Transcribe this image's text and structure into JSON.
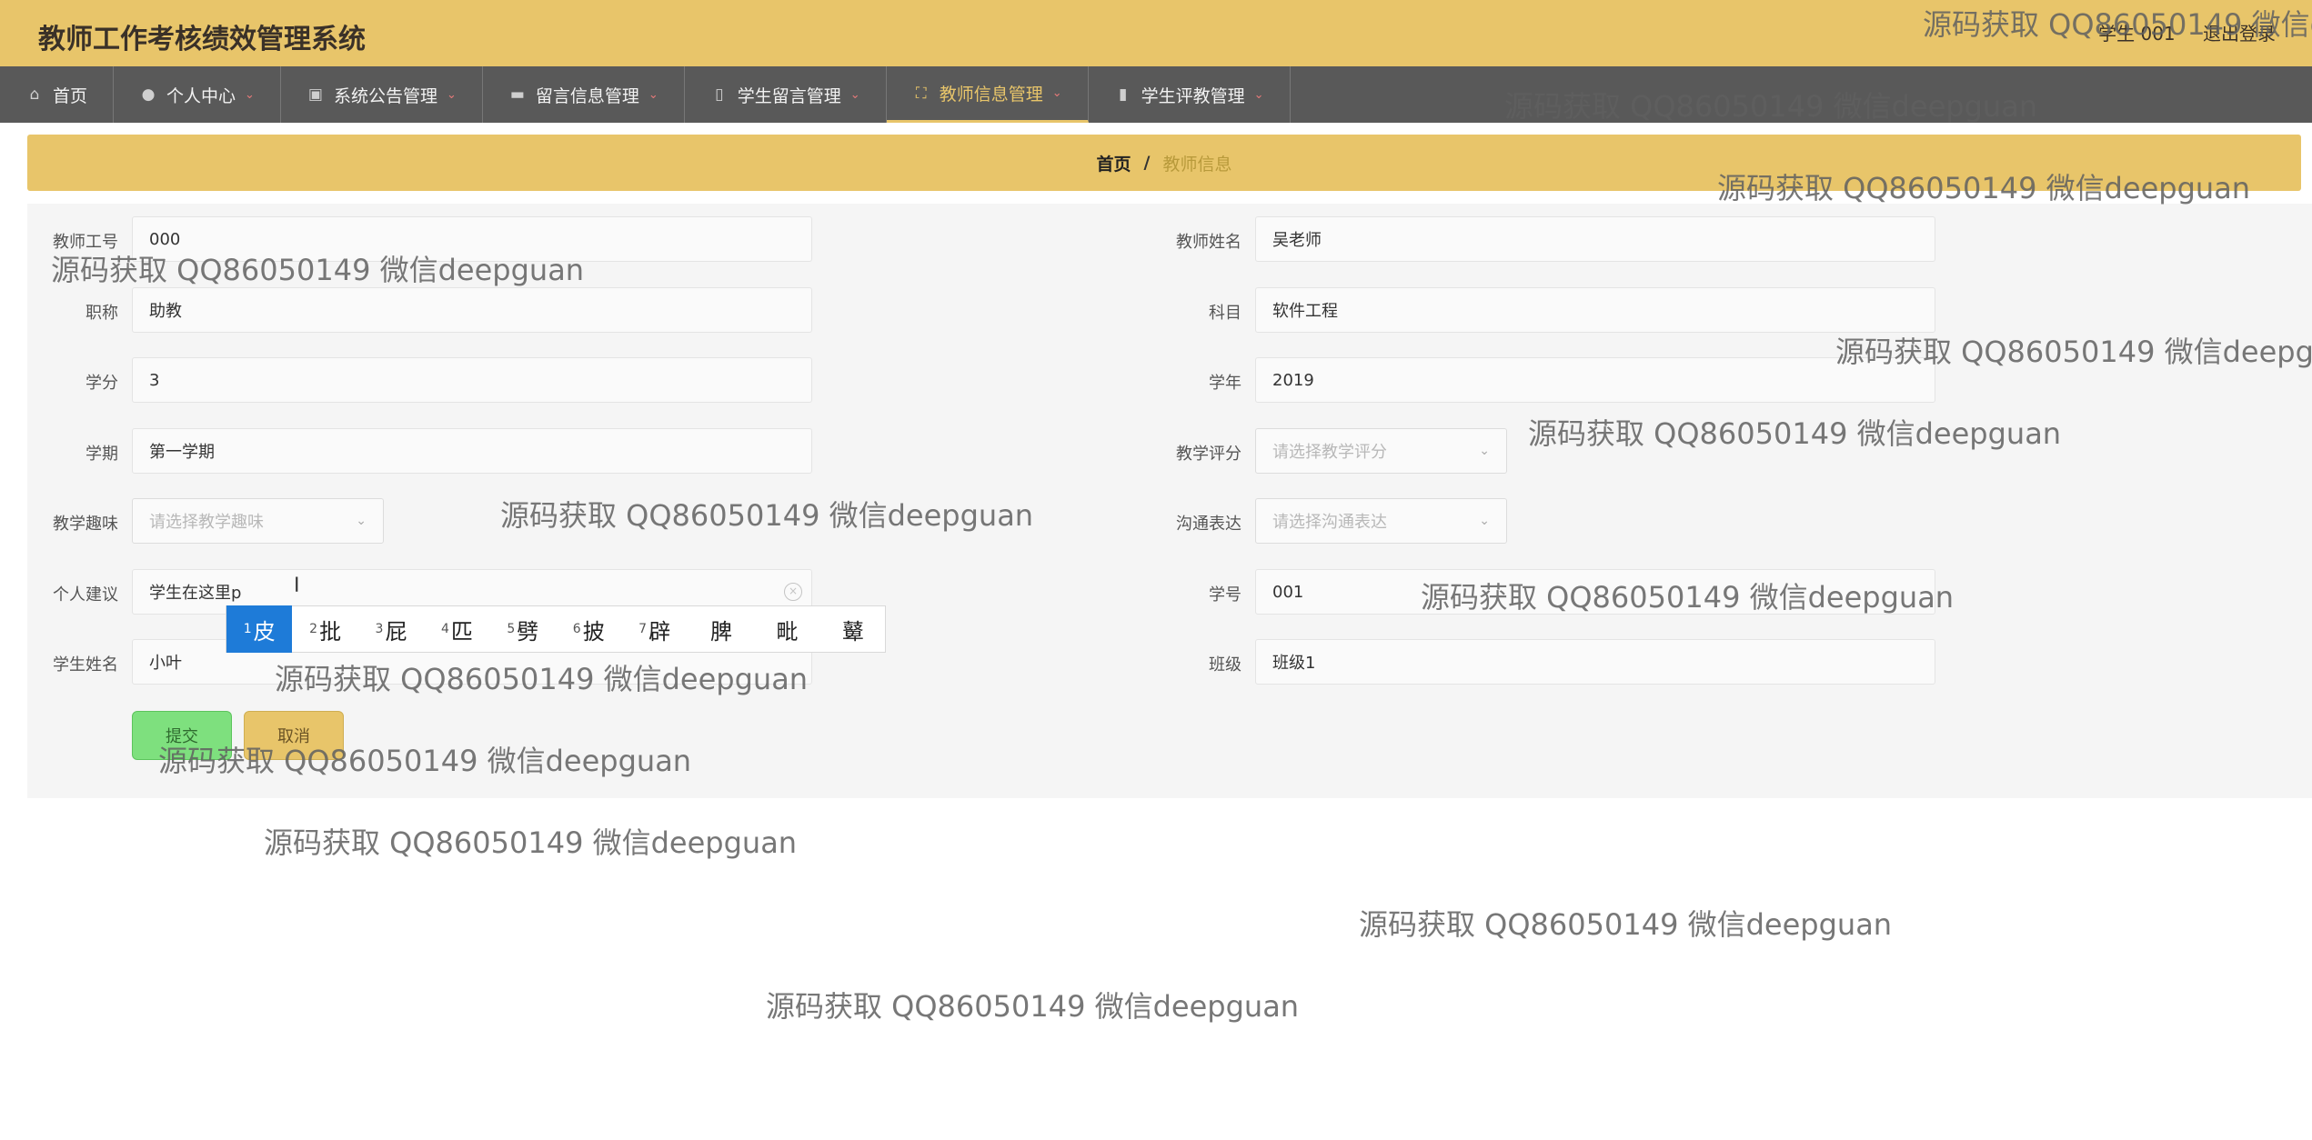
{
  "app": {
    "title": "教师工作考核绩效管理系统",
    "user": "学生 001",
    "logout": "退出登录"
  },
  "nav": [
    {
      "label": "首页",
      "icon": "home-icon",
      "glyph": "⌂",
      "caret": false
    },
    {
      "label": "个人中心",
      "icon": "user-icon",
      "glyph": "●",
      "caret": true
    },
    {
      "label": "系统公告管理",
      "icon": "clipboard-icon",
      "glyph": "▣",
      "caret": true
    },
    {
      "label": "留言信息管理",
      "icon": "message-icon",
      "glyph": "▬",
      "caret": true
    },
    {
      "label": "学生留言管理",
      "icon": "microphone-icon",
      "glyph": "▯",
      "caret": true
    },
    {
      "label": "教师信息管理",
      "icon": "fullscreen-icon",
      "glyph": "⛶",
      "caret": true,
      "active": true
    },
    {
      "label": "学生评教管理",
      "icon": "bar-chart-icon",
      "glyph": "▮",
      "caret": true
    }
  ],
  "breadcrumb": {
    "home": "首页",
    "separator": "/",
    "current": "教师信息"
  },
  "form": {
    "teacher_id": {
      "label": "教师工号",
      "value": "000"
    },
    "teacher_name": {
      "label": "教师姓名",
      "value": "吴老师"
    },
    "title": {
      "label": "职称",
      "value": "助教"
    },
    "subject": {
      "label": "科目",
      "value": "软件工程"
    },
    "credit": {
      "label": "学分",
      "value": "3"
    },
    "year": {
      "label": "学年",
      "value": "2019"
    },
    "semester": {
      "label": "学期",
      "value": "第一学期"
    },
    "teaching_score": {
      "label": "教学评分",
      "placeholder": "请选择教学评分"
    },
    "teaching_interest": {
      "label": "教学趣味",
      "placeholder": "请选择教学趣味"
    },
    "communication": {
      "label": "沟通表达",
      "placeholder": "请选择沟通表达"
    },
    "suggestion": {
      "label": "个人建议",
      "value": "学生在这里p"
    },
    "student_id": {
      "label": "学号",
      "value": "001"
    },
    "student_name": {
      "label": "学生姓名",
      "value": "小叶"
    },
    "class": {
      "label": "班级",
      "value": "班级1"
    }
  },
  "ime": {
    "candidates": [
      {
        "num": "1",
        "text": "皮"
      },
      {
        "num": "2",
        "text": "批"
      },
      {
        "num": "3",
        "text": "屁"
      },
      {
        "num": "4",
        "text": "匹"
      },
      {
        "num": "5",
        "text": "劈"
      },
      {
        "num": "6",
        "text": "披"
      },
      {
        "num": "7",
        "text": "辟"
      },
      {
        "num": "",
        "text": "脾"
      },
      {
        "num": "",
        "text": "毗"
      },
      {
        "num": "",
        "text": "鼙"
      }
    ]
  },
  "buttons": {
    "submit": "提交",
    "cancel": "取消"
  },
  "watermark": {
    "text": "源码获取 QQ86050149 微信deepguan",
    "clipped": "源码获取 QQ86050149 微信de"
  }
}
